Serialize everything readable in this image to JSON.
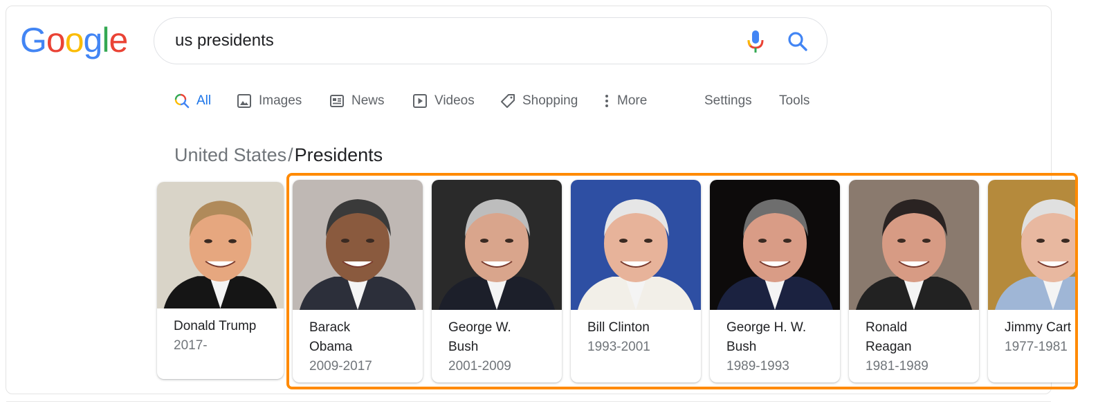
{
  "logo": {
    "letters": [
      {
        "char": "G",
        "color": "#4285F4"
      },
      {
        "char": "o",
        "color": "#EA4335"
      },
      {
        "char": "o",
        "color": "#FBBC05"
      },
      {
        "char": "g",
        "color": "#4285F4"
      },
      {
        "char": "l",
        "color": "#34A853"
      },
      {
        "char": "e",
        "color": "#EA4335"
      }
    ]
  },
  "search": {
    "query": "us presidents",
    "mic_icon": "microphone-icon",
    "search_icon": "search-icon"
  },
  "tabs": [
    {
      "label": "All",
      "icon": "multicolor-search-icon",
      "active": true
    },
    {
      "label": "Images",
      "icon": "image-icon",
      "active": false
    },
    {
      "label": "News",
      "icon": "newspaper-icon",
      "active": false
    },
    {
      "label": "Videos",
      "icon": "play-icon",
      "active": false
    },
    {
      "label": "Shopping",
      "icon": "tag-icon",
      "active": false
    },
    {
      "label": "More",
      "icon": "vertical-dots-icon",
      "active": false
    },
    {
      "label": "Settings",
      "active": false
    },
    {
      "label": "Tools",
      "active": false
    }
  ],
  "breadcrumb": {
    "parent": "United States",
    "separator": "/",
    "current": "Presidents"
  },
  "presidents": [
    {
      "name_line1": "Donald Trump",
      "name_line2": "",
      "years": "2017-",
      "bg": "#d9d4c8"
    },
    {
      "name_line1": "Barack",
      "name_line2": "Obama",
      "years": "2009-2017",
      "bg": "#bfb8b4"
    },
    {
      "name_line1": "George W.",
      "name_line2": "Bush",
      "years": "2001-2009",
      "bg": "#2a2a2a"
    },
    {
      "name_line1": "Bill Clinton",
      "name_line2": "",
      "years": "1993-2001",
      "bg": "#2e4fa3"
    },
    {
      "name_line1": "George H. W.",
      "name_line2": "Bush",
      "years": "1989-1993",
      "bg": "#0d0b0b"
    },
    {
      "name_line1": "Ronald",
      "name_line2": "Reagan",
      "years": "1981-1989",
      "bg": "#8a7a6e"
    },
    {
      "name_line1": "Jimmy Cart",
      "name_line2": "",
      "years": "1977-1981",
      "bg": "#b58a3c"
    }
  ],
  "highlight_color": "#ff8a00"
}
